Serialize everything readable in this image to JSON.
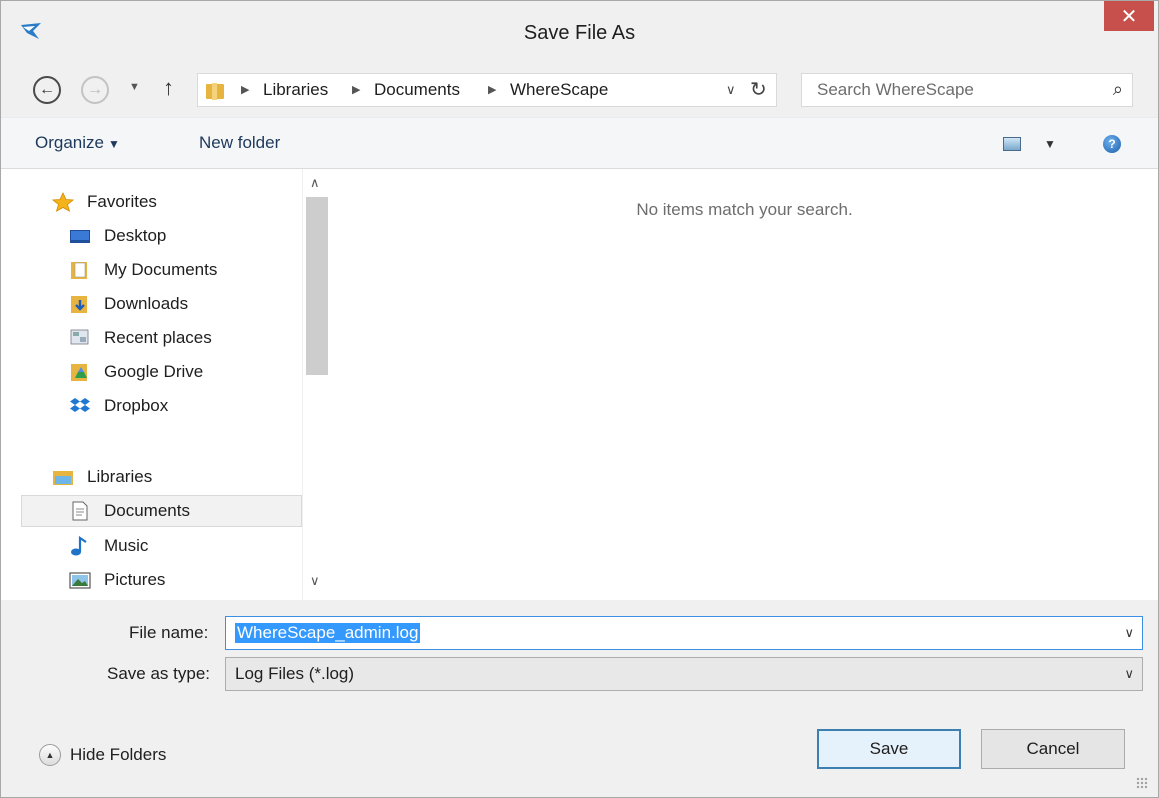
{
  "window": {
    "title": "Save File As",
    "close_icon": "close-icon",
    "accent_close": "#c7504c"
  },
  "nav": {
    "back_icon": "back-arrow-icon",
    "forward_icon": "forward-arrow-icon",
    "recent_icon": "chevron-down-icon",
    "up_icon": "up-arrow-icon",
    "breadcrumb": [
      "Libraries",
      "Documents",
      "WhereScape"
    ],
    "refresh_icon": "refresh-icon",
    "search_placeholder": "Search WhereScape",
    "search_icon": "search-icon"
  },
  "toolbar": {
    "organize_label": "Organize",
    "new_folder_label": "New folder",
    "view_icon": "view-icon",
    "help_icon": "help-icon"
  },
  "sidebar": {
    "items": [
      {
        "label": "Favorites",
        "icon": "star-icon"
      },
      {
        "label": "Desktop",
        "icon": "desktop-icon"
      },
      {
        "label": "My Documents",
        "icon": "documents-folder-icon"
      },
      {
        "label": "Downloads",
        "icon": "downloads-folder-icon"
      },
      {
        "label": "Recent places",
        "icon": "recent-places-icon"
      },
      {
        "label": "Google Drive",
        "icon": "google-drive-icon"
      },
      {
        "label": "Dropbox",
        "icon": "dropbox-icon"
      },
      {
        "label": "Libraries",
        "icon": "libraries-icon"
      },
      {
        "label": "Documents",
        "icon": "document-icon",
        "selected": true
      },
      {
        "label": "Music",
        "icon": "music-note-icon"
      },
      {
        "label": "Pictures",
        "icon": "pictures-icon"
      }
    ]
  },
  "content": {
    "empty_message": "No items match your search."
  },
  "fields": {
    "file_name_label": "File name:",
    "file_name_value": "WhereScape_admin.log",
    "save_type_label": "Save as type:",
    "save_type_value": "Log Files (*.log)"
  },
  "footer": {
    "hide_folders_label": "Hide Folders",
    "save_label": "Save",
    "cancel_label": "Cancel"
  }
}
